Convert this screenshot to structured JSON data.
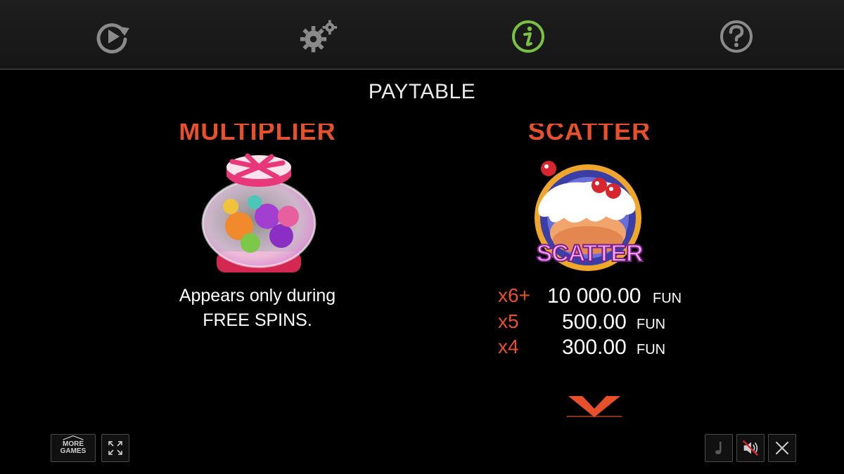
{
  "top_nav": {
    "items": [
      {
        "icon": "autoplay-icon"
      },
      {
        "icon": "settings-icon"
      },
      {
        "icon": "info-icon",
        "active": true
      },
      {
        "icon": "help-icon"
      }
    ],
    "active_color": "#7ac142",
    "icon_color": "#8a8a8a"
  },
  "page": {
    "title": "PAYTABLE"
  },
  "multiplier": {
    "title": "MULTIPLIER",
    "symbol_icon": "candy-jar-icon",
    "desc_line1": "Appears only during",
    "desc_line2": "FREE SPINS."
  },
  "scatter": {
    "title": "SCATTER",
    "symbol_icon": "scatter-cake-icon",
    "symbol_label": "SCATTER",
    "pays": [
      {
        "count": "x6+",
        "amount": "10 000.00",
        "currency": "FUN"
      },
      {
        "count": "x5",
        "amount": "500.00",
        "currency": "FUN"
      },
      {
        "count": "x4",
        "amount": "300.00",
        "currency": "FUN"
      }
    ]
  },
  "bottom_left": {
    "more_games_label": "MORE GAMES",
    "fullscreen_icon": "fullscreen-icon"
  },
  "bottom_right": {
    "music_icon": "music-note-icon",
    "sound_icon": "sound-muted-icon",
    "close_icon": "close-icon"
  },
  "colors": {
    "accent": "#e8502c",
    "background": "#000000",
    "topbar": "#1b1b1b"
  }
}
